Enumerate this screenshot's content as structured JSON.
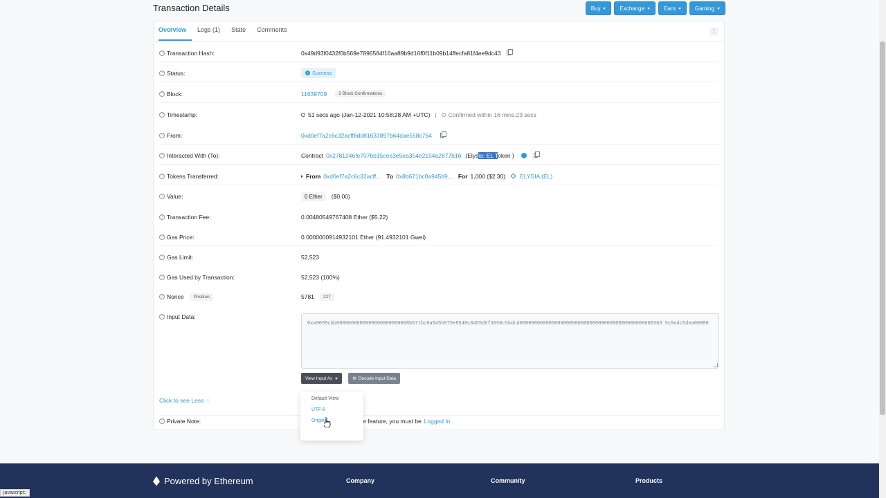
{
  "page": {
    "title": "Transaction Details"
  },
  "top_buttons": [
    "Buy",
    "Exchange",
    "Earn",
    "Gaming"
  ],
  "tabs": [
    "Overview",
    "Logs (1)",
    "State",
    "Comments"
  ],
  "rows": {
    "tx_hash": {
      "label": "Transaction Hash:",
      "value": "0x49d93f0432f0b569e7896584f16aa89b9d16f0f11b09b14ffecfa81f4ee9dc43"
    },
    "status": {
      "label": "Status:",
      "value": "Success"
    },
    "block": {
      "label": "Block:",
      "value": "11639709",
      "confirmations": "2 Block Confirmations"
    },
    "timestamp": {
      "label": "Timestamp:",
      "value": "51 secs ago (Jan-12-2021 10:58:28 AM +UTC)",
      "sep": "|",
      "confirmed": "Confirmed within 16 mins:23 secs"
    },
    "from": {
      "label": "From:",
      "value": "0xd0ef7a2c6c32acff8dd81633897b64dae558c764"
    },
    "interacted": {
      "label": "Interacted With (To):",
      "prefix": "Contract",
      "address": "0x2781246fe707bb15cee3e5ea354e2154a2877b16",
      "name_pre": "(Elys",
      "name_hl": "ia: EL T",
      "name_post": "oken )"
    },
    "tokens": {
      "label": "Tokens Transferred:",
      "from_label": "From",
      "from_addr": "0xd0ef7a2c6c32acff...",
      "to_label": "To",
      "to_addr": "0x8b671bc0a945b9...",
      "for_label": "For",
      "amount": "1,000 ($2.30)",
      "token": "ELYSIA (EL)"
    },
    "value": {
      "label": "Value:",
      "ether": "0 Ether",
      "usd": "($0.00)"
    },
    "fee": {
      "label": "Transaction Fee:",
      "value": "0.00480549767408 Ether ($5.22)"
    },
    "gas_price": {
      "label": "Gas Price:",
      "value": "0.0000000914932101 Ether (91.4932101 Gwei)"
    },
    "gas_limit": {
      "label": "Gas Limit:",
      "value": "52,523"
    },
    "gas_used": {
      "label": "Gas Used by Transaction:",
      "value": "52,523 (100%)"
    },
    "nonce": {
      "label": "Nonce",
      "position_label": "Position",
      "value": "5781",
      "position": "227"
    },
    "input": {
      "label": "Input Data:",
      "value": "0xa9059cbb0000000000000000000000008b671bc0a945b975e8548c8455d6f3650c5bdcd0000000000000000000000000000000000000000000000363 5c9adc5dea00000"
    },
    "note": {
      "label": "Private Note:",
      "text": "ote feature, you must be",
      "link": "Logged In"
    }
  },
  "buttons": {
    "view_input": "View Input As",
    "decode": "Decode Input Data"
  },
  "see_less": "Click to see Less",
  "dropdown": [
    "Default View",
    "UTF-8",
    "Original"
  ],
  "footer": {
    "title": "Powered by Ethereum",
    "cols": [
      "Company",
      "Community",
      "Products"
    ]
  },
  "status_bar": "javascript:;"
}
